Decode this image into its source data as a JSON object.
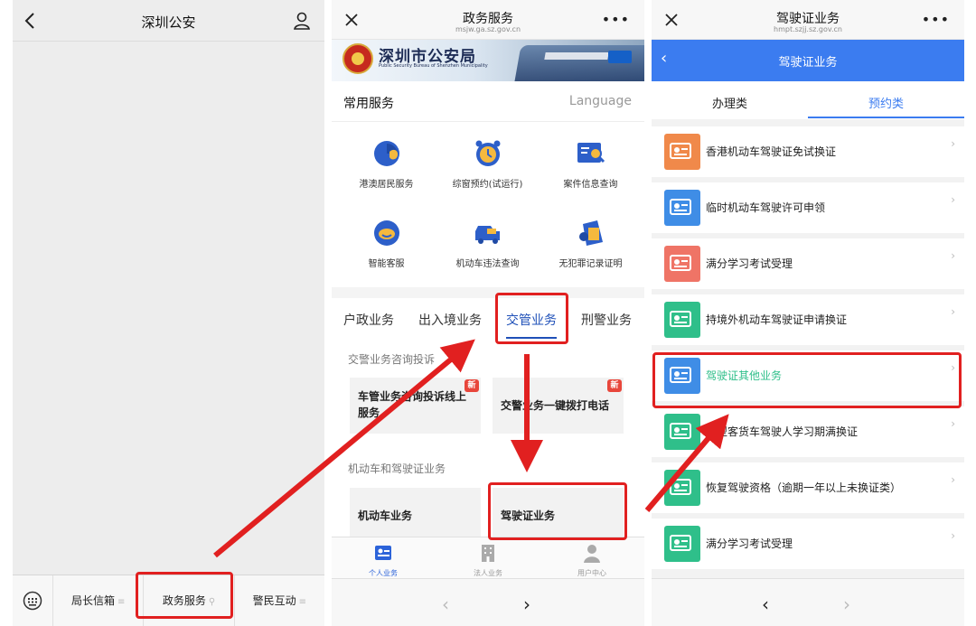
{
  "panel1": {
    "title": "深圳公安",
    "menu": [
      {
        "label": "局长信箱"
      },
      {
        "label": "政务服务"
      },
      {
        "label": "警民互动"
      }
    ]
  },
  "panel2": {
    "header": {
      "title": "政务服务",
      "url": "msjw.ga.sz.gov.cn"
    },
    "banner": {
      "name_cn": "深圳市公安局",
      "name_en": "Public Security Bureau of Shenzhen Municipality"
    },
    "common": {
      "title": "常用服务",
      "language": "Language",
      "items": [
        {
          "label": "港澳居民服务",
          "icon": "hk-macau-resident-icon"
        },
        {
          "label": "综窗预约(试运行)",
          "icon": "alarm-clock-icon"
        },
        {
          "label": "案件信息查询",
          "icon": "case-search-icon"
        },
        {
          "label": "智能客服",
          "icon": "robot-icon"
        },
        {
          "label": "机动车违法查询",
          "icon": "car-violation-icon"
        },
        {
          "label": "无犯罪记录证明",
          "icon": "certificate-icon"
        }
      ]
    },
    "tabs": [
      {
        "label": "户政业务"
      },
      {
        "label": "出入境业务"
      },
      {
        "label": "交管业务"
      },
      {
        "label": "刑警业务"
      }
    ],
    "groups": {
      "g1_title": "交警业务咨询投诉",
      "g1_tile1": "车管业务咨询投诉线上服务",
      "g1_tile2": "交警业务一键拨打电话",
      "g2_title": "机动车和驾驶证业务",
      "g2_tile1": "机动车业务",
      "g2_tile2": "驾驶证业务",
      "new_badge": "新"
    },
    "bottom_nav": [
      {
        "label": "个人业务"
      },
      {
        "label": "法人业务"
      },
      {
        "label": "用户中心"
      }
    ]
  },
  "panel3": {
    "header": {
      "title": "驾驶证业务",
      "url": "hmpt.szjj.sz.gov.cn"
    },
    "bar_title": "驾驶证业务",
    "tabs": [
      {
        "label": "办理类"
      },
      {
        "label": "预约类"
      }
    ],
    "rows": [
      {
        "label": "香港机动车驾驶证免试换证",
        "color": "#f0894a"
      },
      {
        "label": "临时机动车驾驶许可申领",
        "color": "#3f8de6"
      },
      {
        "label": "满分学习考试受理",
        "color": "#ef7466"
      },
      {
        "label": "持境外机动车驾驶证申请换证",
        "color": "#2fbf8a"
      },
      {
        "label": "驾驶证其他业务",
        "color": "#3f8de6"
      },
      {
        "label": "中型客货车驾驶人学习期满换证",
        "color": "#2fbf8a"
      },
      {
        "label": "恢复驾驶资格（逾期一年以上未换证类）",
        "color": "#2fbf8a"
      },
      {
        "label": "满分学习考试受理",
        "color": "#2fbf8a"
      }
    ]
  },
  "colors": {
    "accent_blue": "#3b7cf0",
    "highlight_red": "#e12020",
    "active_green": "#2fbf8a"
  }
}
